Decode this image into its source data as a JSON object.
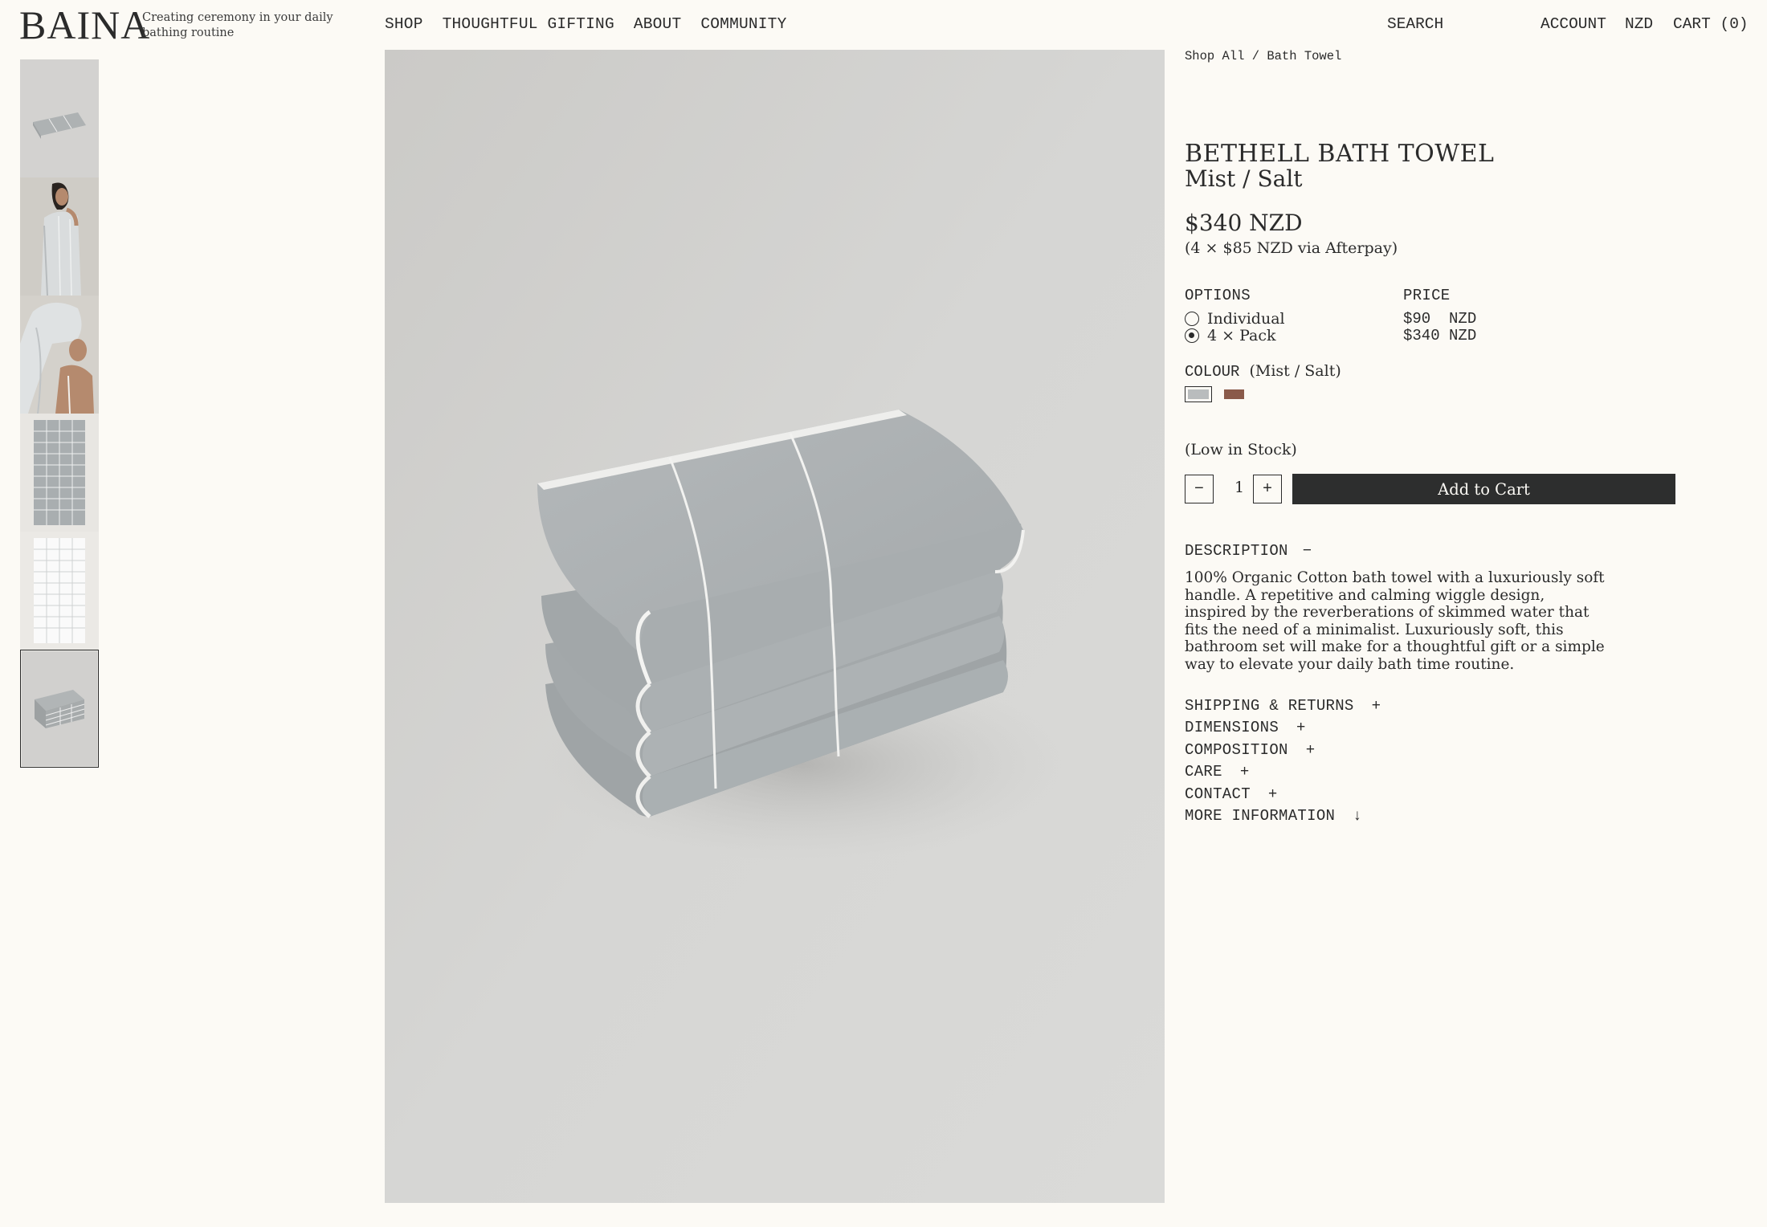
{
  "brand": {
    "logo": "BAINA",
    "tagline": "Creating ceremony in your daily bathing routine"
  },
  "nav": {
    "items": [
      "SHOP",
      "THOUGHTFUL GIFTING",
      "ABOUT",
      "COMMUNITY"
    ],
    "search": "SEARCH",
    "account": "ACCOUNT",
    "currency": "NZD",
    "cart": "CART (0)"
  },
  "thumbnails": {
    "count": 6,
    "active_index": 5,
    "subjects": [
      "folded towel",
      "woman wrapped in towel",
      "woman with towel on head",
      "grey grid towel flat",
      "white grid towel flat",
      "stacked towels"
    ]
  },
  "product": {
    "breadcrumb": "Shop All / Bath Towel",
    "title": "BETHELL BATH TOWEL",
    "subtitle": "Mist / Salt",
    "price": "$340 NZD",
    "afterpay": "(4 × $85 NZD via Afterpay)",
    "options_label": "OPTIONS",
    "price_label": "PRICE",
    "options": [
      {
        "label": "Individual",
        "price": "$90  NZD",
        "selected": false
      },
      {
        "label": "4 × Pack",
        "price": "$340 NZD",
        "selected": true
      }
    ],
    "colour_label": "COLOUR",
    "colour_value": "(Mist / Salt)",
    "swatches": [
      {
        "name": "Mist / Salt",
        "color": "#b9bcbd",
        "selected": true
      },
      {
        "name": "Clay",
        "color": "#8a5a4a",
        "selected": false
      }
    ],
    "stock": "(Low in Stock)",
    "quantity": "1",
    "qty_minus": "−",
    "qty_plus": "+",
    "add_to_cart": "Add to Cart",
    "description_label": "DESCRIPTION",
    "description_toggle": "−",
    "description": "100% Organic Cotton bath towel with a luxuriously soft handle. A repetitive and calming wiggle design, inspired by the reverberations of skimmed water that fits the need of a minimalist. Luxuriously soft, this bathroom set will make for a thoughtful gift or a simple way to elevate your daily bath time routine.",
    "accordions": [
      {
        "label": "SHIPPING & RETURNS",
        "toggle": "+"
      },
      {
        "label": "DIMENSIONS",
        "toggle": "+"
      },
      {
        "label": "COMPOSITION",
        "toggle": "+"
      },
      {
        "label": "CARE",
        "toggle": "+"
      },
      {
        "label": "CONTACT",
        "toggle": "+"
      },
      {
        "label": "MORE INFORMATION",
        "toggle": "↓"
      }
    ]
  },
  "colors": {
    "background": "#fcfaf5",
    "text": "#2b2b2b",
    "button": "#2d2e2e",
    "image_bg": "#d2d1cf",
    "towel": "#a9aeb0"
  }
}
